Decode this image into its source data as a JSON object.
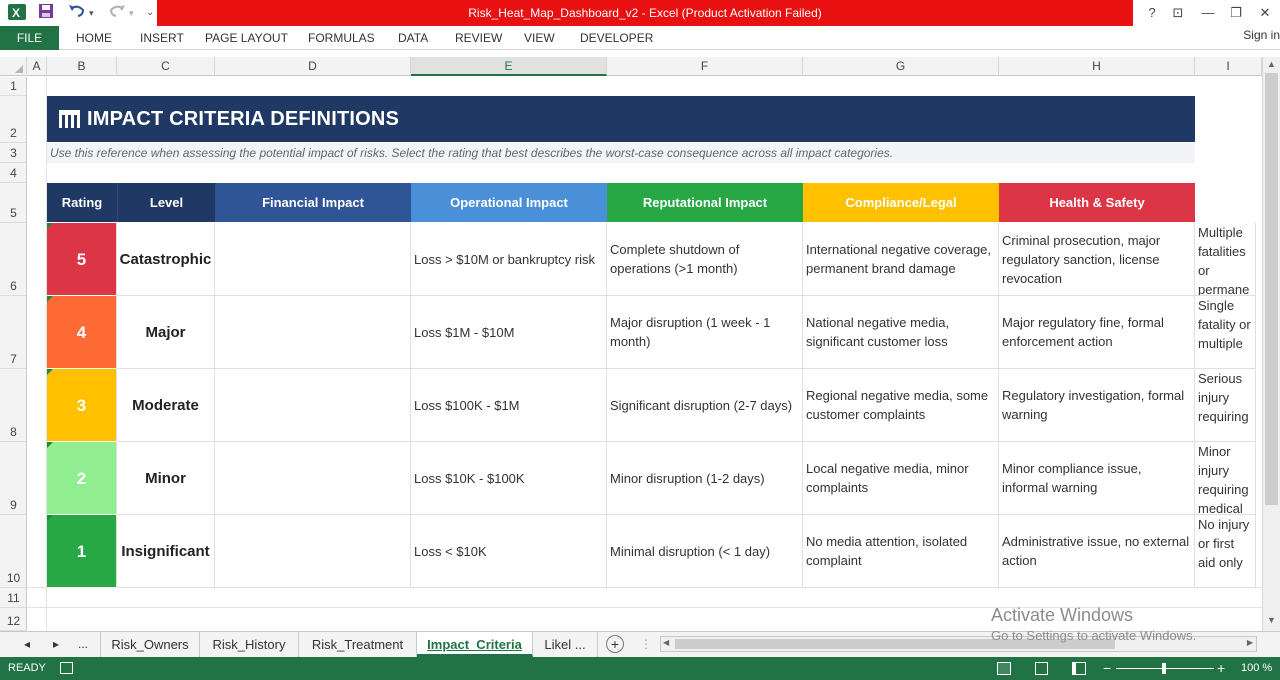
{
  "window": {
    "title": "Risk_Heat_Map_Dashboard_v2 -  Excel (Product Activation Failed)",
    "help": "?",
    "minimize": "—",
    "restore": "❐",
    "close": "✕",
    "ribbon_display": "⊡"
  },
  "quick_access": {
    "more": "⌄"
  },
  "ribbon": {
    "file": "FILE",
    "tabs": [
      "HOME",
      "INSERT",
      "PAGE LAYOUT",
      "FORMULAS",
      "DATA",
      "REVIEW",
      "VIEW",
      "DEVELOPER"
    ],
    "sign_in": "Sign in"
  },
  "columns": [
    "A",
    "B",
    "C",
    "D",
    "E",
    "F",
    "G",
    "H",
    "I"
  ],
  "rows": [
    "1",
    "2",
    "3",
    "4",
    "5",
    "6",
    "7",
    "8",
    "9",
    "10",
    "11",
    "12"
  ],
  "sheet": {
    "title": "IMPACT CRITERIA DEFINITIONS",
    "subtitle": "Use this reference when assessing the potential impact of risks. Select the rating that best describes the worst-case consequence across all impact categories.",
    "headers": [
      "Rating",
      "Level",
      "Financial Impact",
      "Operational Impact",
      "Reputational Impact",
      "Compliance/Legal",
      "Health & Safety"
    ],
    "header_colors": [
      "#1f3864",
      "#1f3864",
      "#2f5597",
      "#4a90d9",
      "#28a745",
      "#ffc000",
      "#dc3545"
    ],
    "rows": [
      {
        "rating": "5",
        "color": "#dc3545",
        "level": "Catastrophic",
        "financial": "",
        "operational": "Loss > $10M or bankruptcy risk",
        "reputational": "Complete shutdown of operations (>1 month)",
        "compliance": "International negative coverage, permanent brand damage",
        "health": "Criminal prosecution, major regulatory sanction, license revocation",
        "extra": "Multiple fatalities or permane"
      },
      {
        "rating": "4",
        "color": "#ff6b35",
        "level": "Major",
        "financial": "",
        "operational": "Loss $1M - $10M",
        "reputational": "Major disruption (1 week - 1 month)",
        "compliance": "National negative media, significant customer loss",
        "health": "Major regulatory fine, formal enforcement action",
        "extra": "Single fatality or multiple"
      },
      {
        "rating": "3",
        "color": "#ffc000",
        "level": "Moderate",
        "financial": "",
        "operational": "Loss $100K - $1M",
        "reputational": "Significant disruption (2-7 days)",
        "compliance": "Regional negative media, some customer complaints",
        "health": "Regulatory investigation, formal warning",
        "extra": "Serious injury requiring"
      },
      {
        "rating": "2",
        "color": "#90ee90",
        "level": "Minor",
        "financial": "",
        "operational": "Loss $10K - $100K",
        "reputational": "Minor disruption (1-2 days)",
        "compliance": "Local negative media, minor complaints",
        "health": "Minor compliance issue, informal warning",
        "extra": "Minor injury requiring  medical"
      },
      {
        "rating": "1",
        "color": "#28a745",
        "level": "Insignificant",
        "financial": "",
        "operational": "Loss < $10K",
        "reputational": "Minimal disruption (< 1 day)",
        "compliance": "No media attention, isolated complaint",
        "health": "Administrative issue, no external action",
        "extra": "No injury or first aid only"
      }
    ]
  },
  "sheet_tabs": {
    "items": [
      "Risk_Owners",
      "Risk_History",
      "Risk_Treatment",
      "Impact_Criteria",
      "Likel ..."
    ],
    "active": "Impact_Criteria",
    "ellipsis": "...",
    "add": "+"
  },
  "status": {
    "ready": "READY",
    "zoom": "100 %",
    "zoom_minus": "−",
    "zoom_plus": "+"
  },
  "watermark": {
    "line1": "Activate Windows",
    "line2": "Go to Settings to activate Windows."
  }
}
